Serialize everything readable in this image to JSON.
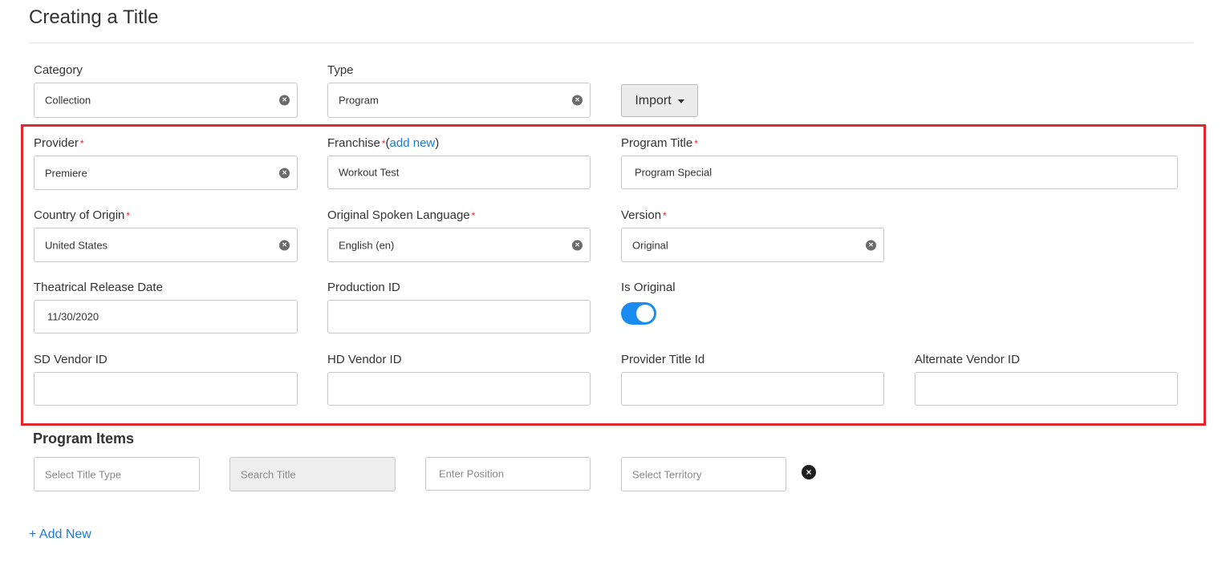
{
  "page": {
    "title": "Creating a Title"
  },
  "category": {
    "label": "Category",
    "value": "Collection"
  },
  "type": {
    "label": "Type",
    "value": "Program"
  },
  "import_button": {
    "label": "Import"
  },
  "provider": {
    "label": "Provider",
    "required": "*",
    "value": "Premiere"
  },
  "franchise": {
    "label": "Franchise",
    "required": "*",
    "open_paren": "(",
    "add_new_link": "add new",
    "close_paren": ")",
    "value": "Workout Test"
  },
  "program_title": {
    "label": "Program Title",
    "required": "*",
    "value": "Program Special"
  },
  "country_of_origin": {
    "label": "Country of Origin",
    "required": "*",
    "value": "United States"
  },
  "original_spoken_language": {
    "label": "Original Spoken Language",
    "required": "*",
    "value": "English (en)"
  },
  "version": {
    "label": "Version",
    "required": "*",
    "value": "Original"
  },
  "theatrical_release_date": {
    "label": "Theatrical Release Date",
    "value": "11/30/2020"
  },
  "production_id": {
    "label": "Production ID",
    "value": ""
  },
  "is_original": {
    "label": "Is Original",
    "on": true
  },
  "sd_vendor_id": {
    "label": "SD Vendor ID",
    "value": ""
  },
  "hd_vendor_id": {
    "label": "HD Vendor ID",
    "value": ""
  },
  "provider_title_id": {
    "label": "Provider Title Id",
    "value": ""
  },
  "alternate_vendor_id": {
    "label": "Alternate Vendor ID",
    "value": ""
  },
  "program_items": {
    "heading": "Program Items",
    "title_type_placeholder": "Select Title Type",
    "search_title_placeholder": "Search Title",
    "position_placeholder": "Enter Position",
    "territory_placeholder": "Select Territory",
    "add_new_label": "+ Add New"
  },
  "colors": {
    "accent": "#1a8cf0",
    "highlight": "#e0262f",
    "link": "#1a7bd8"
  },
  "icons": {
    "clear": "circle-x-icon",
    "remove": "circle-x-icon"
  }
}
